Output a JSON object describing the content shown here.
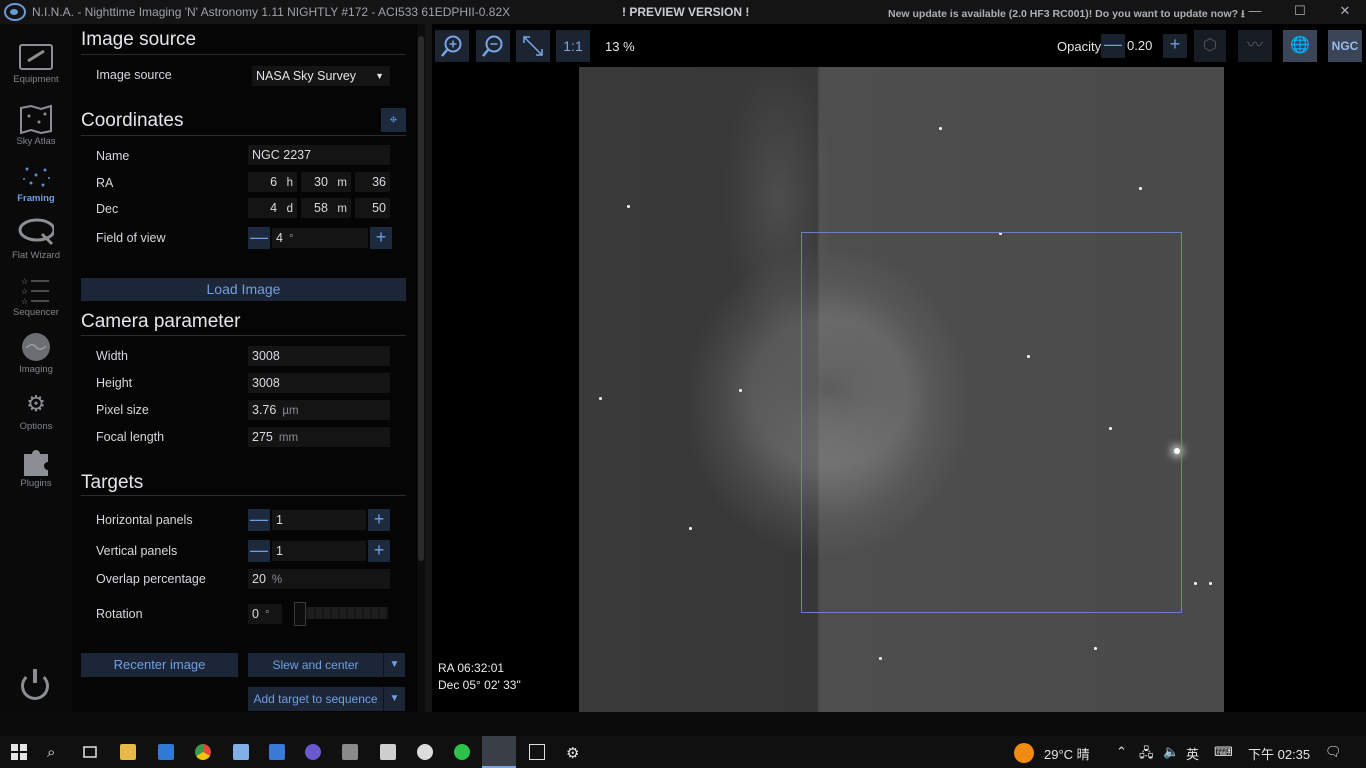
{
  "window": {
    "title": "N.I.N.A. - Nighttime Imaging 'N' Astronomy 1.11 NIGHTLY #172  -  ACI533 61EDPHII-0.82X",
    "preview": "! PREVIEW VERSION !",
    "update": "New update is available (2.0 HF3 RC001)! Do you want to update now? ⭳",
    "minimize": "—",
    "maximize": "☐",
    "close": "✕"
  },
  "nav": [
    {
      "label": "Equipment",
      "icon": "telescope-icon"
    },
    {
      "label": "Sky Atlas",
      "icon": "atlas-icon"
    },
    {
      "label": "Framing",
      "icon": "framing-icon"
    },
    {
      "label": "Flat Wizard",
      "icon": "flat-wizard-icon"
    },
    {
      "label": "Sequencer",
      "icon": "sequencer-icon"
    },
    {
      "label": "Imaging",
      "icon": "imaging-icon"
    },
    {
      "label": "Options",
      "icon": "gears-icon"
    },
    {
      "label": "Plugins",
      "icon": "puzzle-icon"
    }
  ],
  "image_source": {
    "title": "Image source",
    "label": "Image source",
    "value": "NASA Sky Survey"
  },
  "coordinates": {
    "title": "Coordinates",
    "name_label": "Name",
    "name_value": "NGC 2237",
    "ra_label": "RA",
    "ra_h": "6",
    "ra_h_unit": "h",
    "ra_m": "30",
    "ra_m_unit": "m",
    "ra_s": "36",
    "dec_label": "Dec",
    "dec_d": "4",
    "dec_d_unit": "d",
    "dec_m": "58",
    "dec_m_unit": "m",
    "dec_s": "50",
    "fov_label": "Field of view",
    "fov_value": "4",
    "fov_unit": "°"
  },
  "load_image": "Load Image",
  "camera": {
    "title": "Camera parameter",
    "width_label": "Width",
    "width_value": "3008",
    "height_label": "Height",
    "height_value": "3008",
    "pixel_label": "Pixel size",
    "pixel_value": "3.76",
    "pixel_unit": "µm",
    "focal_label": "Focal length",
    "focal_value": "275",
    "focal_unit": "mm"
  },
  "targets": {
    "title": "Targets",
    "hpanels_label": "Horizontal panels",
    "hpanels_value": "1",
    "vpanels_label": "Vertical panels",
    "vpanels_value": "1",
    "overlap_label": "Overlap percentage",
    "overlap_value": "20",
    "overlap_unit": "%",
    "rotation_label": "Rotation",
    "rotation_value": "0",
    "rotation_unit": "°"
  },
  "actions": {
    "recenter": "Recenter image",
    "slew": "Slew and center",
    "add_target": "Add target to sequence"
  },
  "viewer": {
    "zoom_in": "+",
    "zoom_out": "−",
    "fit": "⤡",
    "one_to_one": "1:1",
    "zoom_percent": "13 %",
    "opacity_label": "Opacity",
    "opacity_value": "0.20",
    "ngc_label": "NGC",
    "cursor_ra": "RA  06:32:01",
    "cursor_dec": "Dec  05° 02' 33\""
  },
  "taskbar": {
    "weather": "29°C  晴",
    "ime": "英",
    "time": "下午 02:35"
  }
}
